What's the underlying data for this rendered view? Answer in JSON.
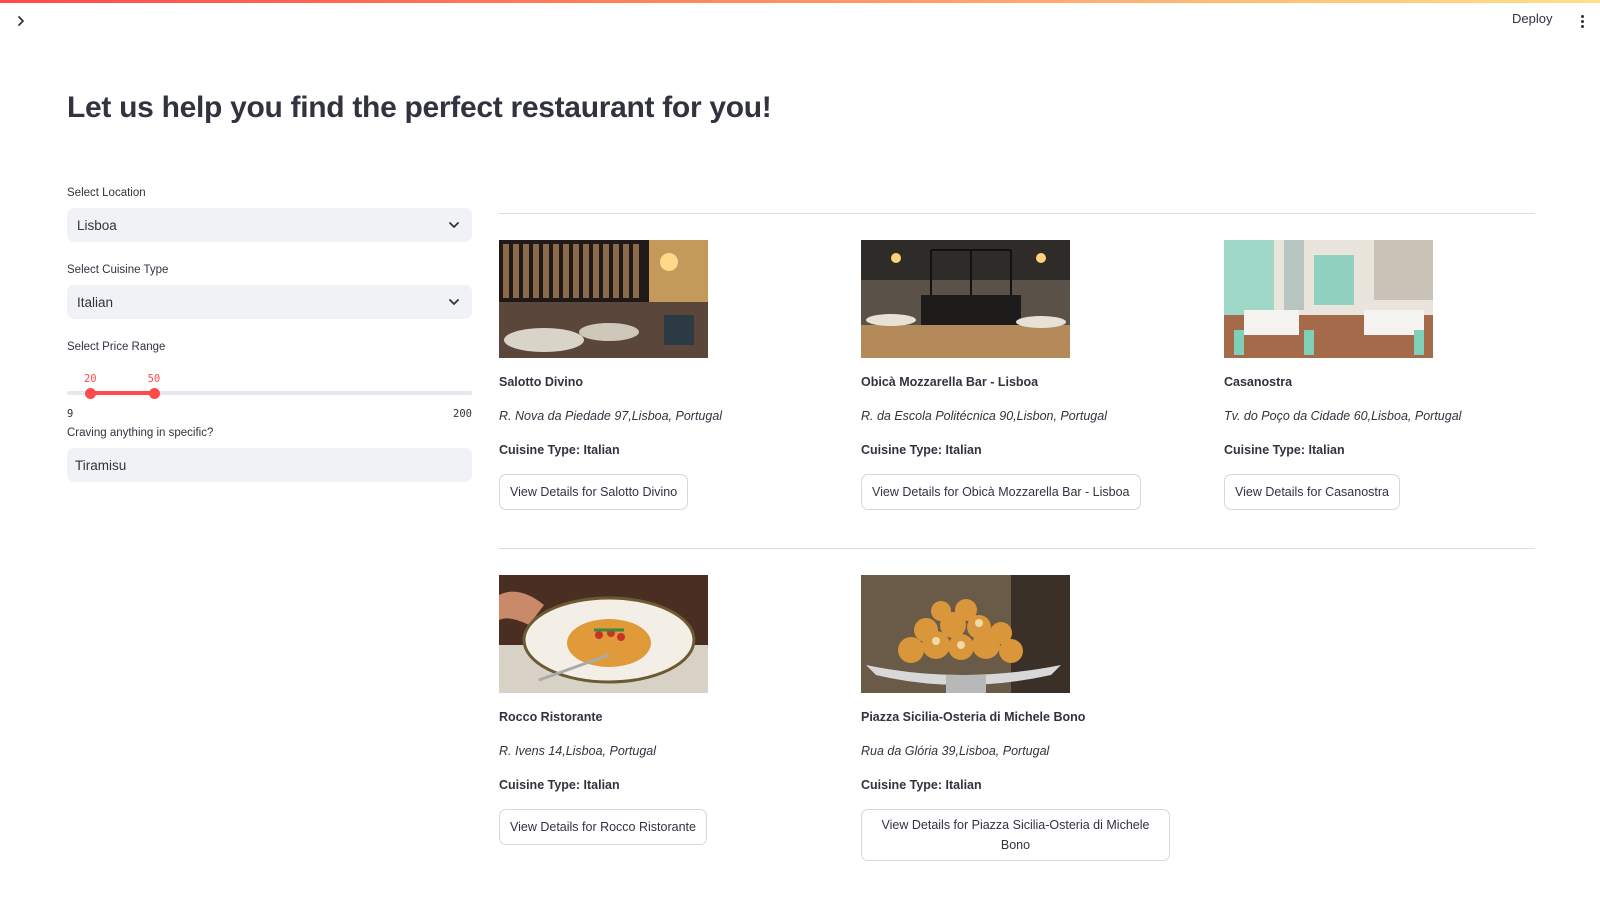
{
  "header": {
    "deploy_label": "Deploy",
    "sidebar_toggle_icon": "chevron-right-icon",
    "menu_icon": "kebab-menu-icon"
  },
  "title": "Let us help you find the perfect restaurant for you!",
  "filters": {
    "location": {
      "label": "Select Location",
      "value": "Lisboa"
    },
    "cuisine": {
      "label": "Select Cuisine Type",
      "value": "Italian"
    },
    "price": {
      "label": "Select Price Range",
      "low": 20,
      "high": 50,
      "min": 9,
      "max": 200
    },
    "craving": {
      "label": "Craving anything in specific?",
      "value": "Tiramisu"
    }
  },
  "restaurants": [
    {
      "name": "Salotto Divino",
      "address": "R. Nova da Piedade 97,Lisboa, Portugal",
      "cuisine": "Cuisine Type: Italian",
      "button": "View Details for Salotto Divino"
    },
    {
      "name": "Obicà Mozzarella Bar - Lisboa",
      "address": "R. da Escola Politécnica 90,Lisbon, Portugal",
      "cuisine": "Cuisine Type: Italian",
      "button": "View Details for Obicà Mozzarella Bar - Lisboa"
    },
    {
      "name": "Casanostra",
      "address": "Tv. do Poço da Cidade 60,Lisboa, Portugal",
      "cuisine": "Cuisine Type: Italian",
      "button": "View Details for Casanostra"
    },
    {
      "name": "Rocco Ristorante",
      "address": "R. Ivens 14,Lisboa, Portugal",
      "cuisine": "Cuisine Type: Italian",
      "button": "View Details for Rocco Ristorante"
    },
    {
      "name": "Piazza Sicilia-Osteria di Michele Bono",
      "address": "Rua da Glória 39,Lisboa, Portugal",
      "cuisine": "Cuisine Type: Italian",
      "button": "View Details for Piazza Sicilia-Osteria di Michele Bono"
    }
  ],
  "colors": {
    "accent": "#ff4b4b",
    "input_bg": "#f0f2f6",
    "text": "#31333f"
  }
}
